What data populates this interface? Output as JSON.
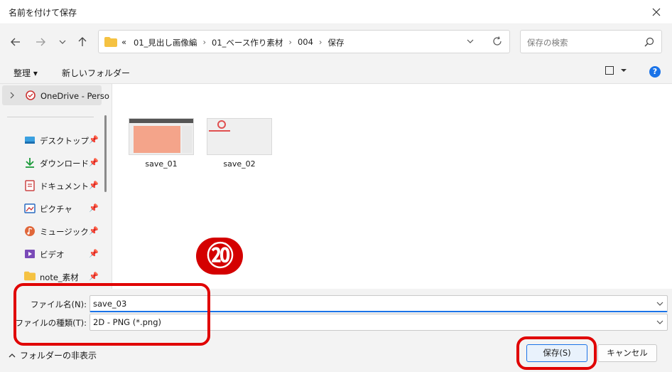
{
  "window": {
    "title": "名前を付けて保存"
  },
  "nav": {
    "breadcrumbs": [
      "01_見出し画像編",
      "01_ベース作り素材",
      "004",
      "保存"
    ],
    "overflow": "«",
    "search_placeholder": "保存の検索"
  },
  "toolbar": {
    "organize_label": "整理 ▾",
    "new_folder_label": "新しいフォルダー"
  },
  "sidebar": {
    "onedrive_label": "OneDrive - Perso",
    "items": [
      {
        "label": "デスクトップ",
        "icon": "desktop-icon"
      },
      {
        "label": "ダウンロード",
        "icon": "download-icon"
      },
      {
        "label": "ドキュメント",
        "icon": "documents-icon"
      },
      {
        "label": "ピクチャ",
        "icon": "pictures-icon"
      },
      {
        "label": "ミュージック",
        "icon": "music-icon"
      },
      {
        "label": "ビデオ",
        "icon": "videos-icon"
      },
      {
        "label": "note_素材",
        "icon": "folder-icon"
      }
    ]
  },
  "files": [
    {
      "name": "save_01"
    },
    {
      "name": "save_02"
    }
  ],
  "annotation": {
    "step_number": "⑳"
  },
  "form": {
    "filename_label": "ファイル名(N):",
    "filename_value": "save_03",
    "filetype_label": "ファイルの種類(T):",
    "filetype_value": "2D - PNG (*.png)"
  },
  "footer": {
    "hide_folders_label": "フォルダーの非表示",
    "save_label": "保存(S)",
    "cancel_label": "キャンセル"
  },
  "colors": {
    "accent": "#1a73e8",
    "annotation_red": "#e00000"
  }
}
